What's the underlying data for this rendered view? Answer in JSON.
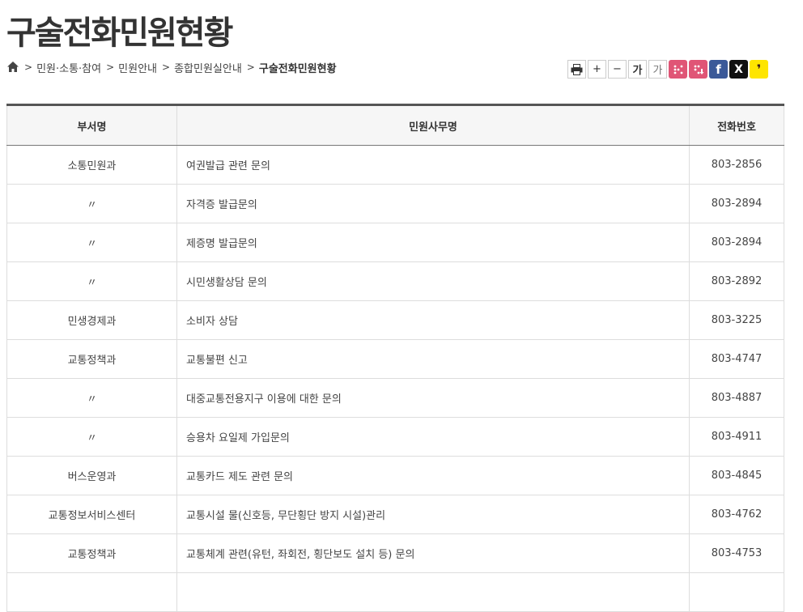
{
  "page": {
    "title": "구술전화민원현황"
  },
  "breadcrumb": {
    "items": [
      "민원·소통·참여",
      "민원안내",
      "종합민원실안내"
    ],
    "current": "구술전화민원현황"
  },
  "tools": {
    "plus": "+",
    "minus": "−",
    "font_bold": "가",
    "font_light": "가",
    "facebook": "f",
    "twitter_x": "X",
    "kakao": "❜"
  },
  "table": {
    "headers": [
      "부서명",
      "민원사무명",
      "전화번호"
    ],
    "rows": [
      {
        "dept": "소통민원과",
        "task": "여권발급 관련 문의",
        "phone": "803-2856"
      },
      {
        "dept": "〃",
        "task": "자격증 발급문의",
        "phone": "803-2894"
      },
      {
        "dept": "〃",
        "task": "제증명 발급문의",
        "phone": "803-2894"
      },
      {
        "dept": "〃",
        "task": "시민생활상담 문의",
        "phone": "803-2892"
      },
      {
        "dept": "민생경제과",
        "task": "소비자 상담",
        "phone": "803-3225"
      },
      {
        "dept": "교통정책과",
        "task": "교통불편 신고",
        "phone": "803-4747"
      },
      {
        "dept": "〃",
        "task": "대중교통전용지구 이용에 대한 문의",
        "phone": "803-4887"
      },
      {
        "dept": "〃",
        "task": "승용차 요일제 가입문의",
        "phone": "803-4911"
      },
      {
        "dept": "버스운영과",
        "task": "교통카드 제도 관련 문의",
        "phone": "803-4845"
      },
      {
        "dept": "교통정보서비스센터",
        "task": "교통시설 물(신호등, 무단횡단 방지 시설)관리",
        "phone": "803-4762"
      },
      {
        "dept": "교통정책과",
        "task": "교통체계 관련(유턴, 좌회전, 횡단보도 설치 등) 문의",
        "phone": "803-4753"
      },
      {
        "dept": "",
        "task": "",
        "phone": ""
      }
    ]
  }
}
